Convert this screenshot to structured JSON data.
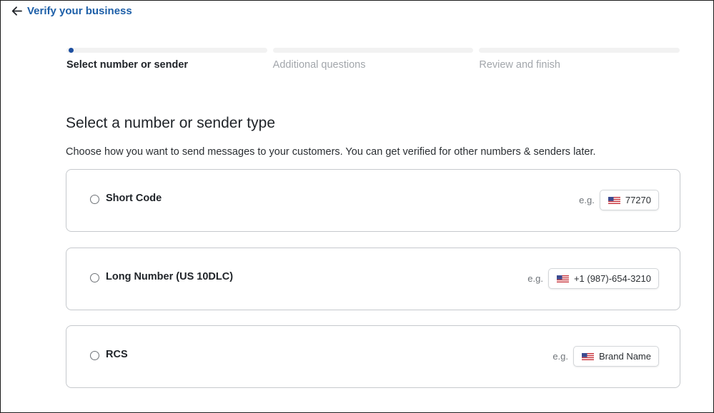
{
  "header": {
    "back_label": "Verify your business"
  },
  "stepper": {
    "steps": [
      {
        "label": "Select number or sender",
        "active": true
      },
      {
        "label": "Additional questions",
        "active": false
      },
      {
        "label": "Review and finish",
        "active": false
      }
    ]
  },
  "main": {
    "title": "Select a number or sender type",
    "description": "Choose how you want to send messages to your customers. You can get verified for other numbers & senders later.",
    "options": [
      {
        "label": "Short Code",
        "eg_label": "e.g.",
        "example": "77270",
        "flag_icon": "us-flag-icon"
      },
      {
        "label": "Long Number (US 10DLC)",
        "eg_label": "e.g.",
        "example": "+1 (987)-654-3210",
        "flag_icon": "us-flag-icon"
      },
      {
        "label": "RCS",
        "eg_label": "e.g.",
        "example": "Brand Name",
        "flag_icon": "us-flag-icon"
      }
    ]
  },
  "colors": {
    "accent": "#1d5fa8",
    "step_active_dot": "#1d4fa0",
    "border": "#c6c9cd"
  }
}
